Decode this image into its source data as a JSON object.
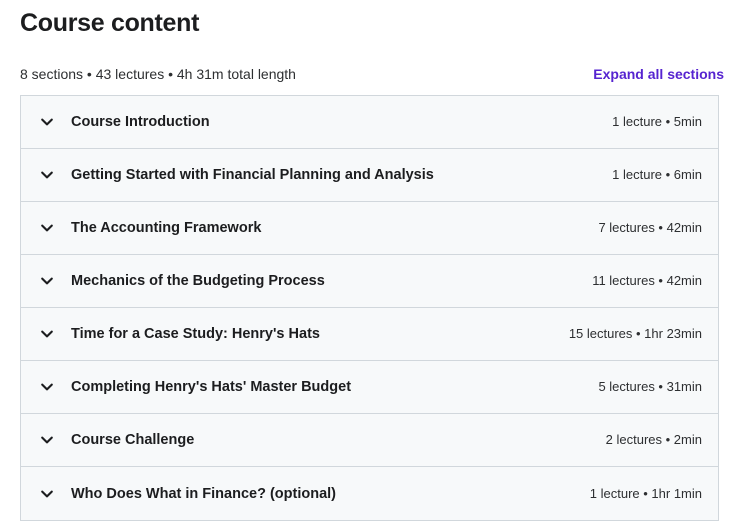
{
  "header": {
    "title": "Course content",
    "summary": "8 sections • 43 lectures • 4h 31m total length",
    "expand_all_label": "Expand all sections"
  },
  "colors": {
    "accent": "#5624d0",
    "text_primary": "#1c1d1f",
    "text_secondary": "#2d2f31",
    "row_background": "#f7f9fa",
    "border": "#d1d7dc",
    "page_background": "#ffffff"
  },
  "icons": {
    "chevron": "chevron-down-icon"
  },
  "sections": [
    {
      "title": "Course Introduction",
      "meta": "1 lecture • 5min",
      "lectures": 1,
      "duration": "5min",
      "expanded": false
    },
    {
      "title": "Getting Started with Financial Planning and Analysis",
      "meta": "1 lecture • 6min",
      "lectures": 1,
      "duration": "6min",
      "expanded": false
    },
    {
      "title": "The Accounting Framework",
      "meta": "7 lectures • 42min",
      "lectures": 7,
      "duration": "42min",
      "expanded": false
    },
    {
      "title": "Mechanics of the Budgeting Process",
      "meta": "11 lectures • 42min",
      "lectures": 11,
      "duration": "42min",
      "expanded": false
    },
    {
      "title": "Time for a Case Study: Henry's Hats",
      "meta": "15 lectures • 1hr 23min",
      "lectures": 15,
      "duration": "1hr 23min",
      "expanded": false
    },
    {
      "title": "Completing Henry's Hats' Master Budget",
      "meta": "5 lectures • 31min",
      "lectures": 5,
      "duration": "31min",
      "expanded": false
    },
    {
      "title": "Course Challenge",
      "meta": "2 lectures • 2min",
      "lectures": 2,
      "duration": "2min",
      "expanded": false
    },
    {
      "title": "Who Does What in Finance? (optional)",
      "meta": "1 lecture • 1hr 1min",
      "lectures": 1,
      "duration": "1hr 1min",
      "expanded": false
    }
  ]
}
